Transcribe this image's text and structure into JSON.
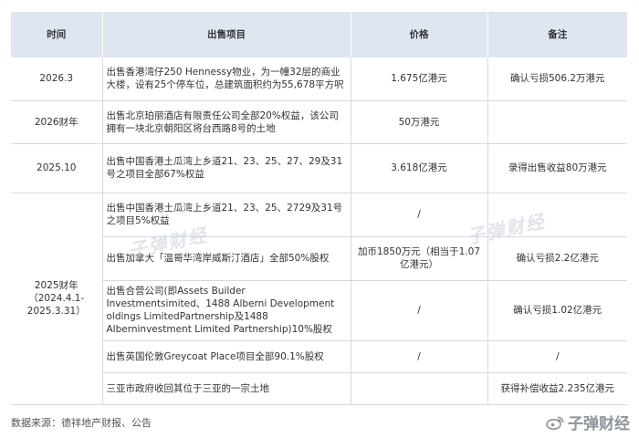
{
  "table": {
    "headers": [
      "时间",
      "出售项目",
      "价格",
      "备注"
    ],
    "rows": [
      {
        "time": "2026.3",
        "item": "出售香港湾仔250 Hennessy物业，为一幢32层的商业大楼，设有25个停车位，总建筑面积约为55,678平方呎",
        "price": "1.675亿港元",
        "note": "确认亏损506.2万港元"
      },
      {
        "time": "2026财年",
        "item": "出售北京珀丽酒店有限责任公司全部20%权益，该公司拥有一块北京朝阳区将台西路8号的土地",
        "price": "50万港元",
        "note": ""
      },
      {
        "time": "2025.10",
        "item": "出售中国香港土瓜湾上乡道21、23、25、27、29及31号之项目全部67%权益",
        "price": "3.618亿港元",
        "note": "录得出售收益80万港元"
      },
      {
        "time": "2025财年\n（2024.4.1-\n2025.3.31）",
        "item": "出售中国香港土瓜湾上乡道21、23、25、2729及31号之项目5%权益",
        "price": "/",
        "note": ""
      },
      {
        "item": "出售加拿大「温哥华湾岸威斯汀酒店」全部50%股权",
        "price": "加币1850万元（相当于1.07亿港元）",
        "note": "确认亏损2.2亿港元"
      },
      {
        "item": "出售合营公司(即Assets Builder Investmentsimited、1488 Alberni Development oldings LimitedPartnership及1488 Alberninvestment Limited Partnership)10%股权",
        "price": "/",
        "note": "确认亏损1.02亿港元"
      },
      {
        "item": "出售英国伦敦Greycoat Place项目全部90.1%股权",
        "price": "/",
        "note": "/"
      },
      {
        "item": "三亚市政府收回其位于三亚的一宗土地",
        "price": "",
        "note": "获得补偿收益2.235亿港元"
      }
    ]
  },
  "source": "数据来源：德祥地产财报、公告",
  "watermark": "子弹财经",
  "brand": "子弹财经"
}
